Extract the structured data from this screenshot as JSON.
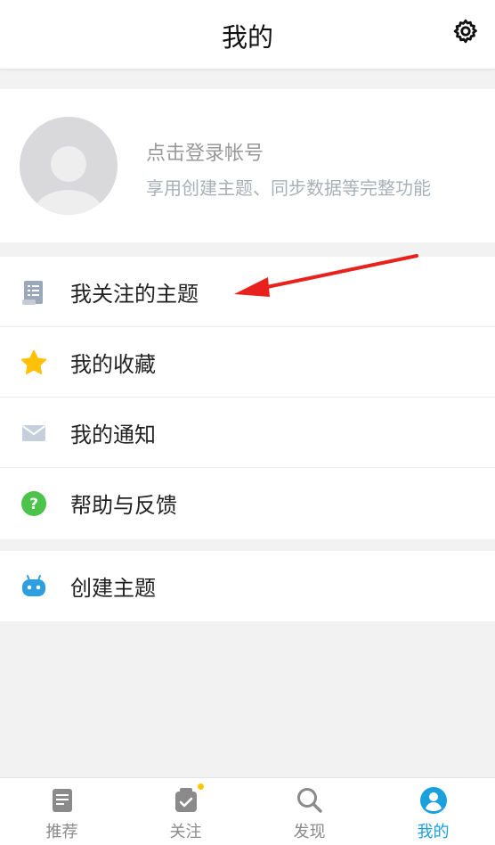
{
  "header": {
    "title": "我的",
    "settings_icon": "gear-icon"
  },
  "profile": {
    "login_text": "点击登录帐号",
    "subtitle": "享用创建主题、同步数据等完整功能"
  },
  "menu": {
    "items": [
      {
        "label": "我关注的主题",
        "icon": "document-list-icon"
      },
      {
        "label": "我的收藏",
        "icon": "star-icon"
      },
      {
        "label": "我的通知",
        "icon": "envelope-icon"
      },
      {
        "label": "帮助与反馈",
        "icon": "help-circle-icon"
      }
    ],
    "create": {
      "label": "创建主题",
      "icon": "robot-icon"
    }
  },
  "annotation": {
    "color": "#e8211c"
  },
  "tabbar": {
    "tabs": [
      {
        "label": "推荐",
        "icon": "article-icon"
      },
      {
        "label": "关注",
        "icon": "checked-box-icon"
      },
      {
        "label": "发现",
        "icon": "search-icon"
      },
      {
        "label": "我的",
        "icon": "user-circle-icon"
      }
    ],
    "active_color": "#1aa0dc",
    "inactive_color": "#8a8a8a"
  }
}
